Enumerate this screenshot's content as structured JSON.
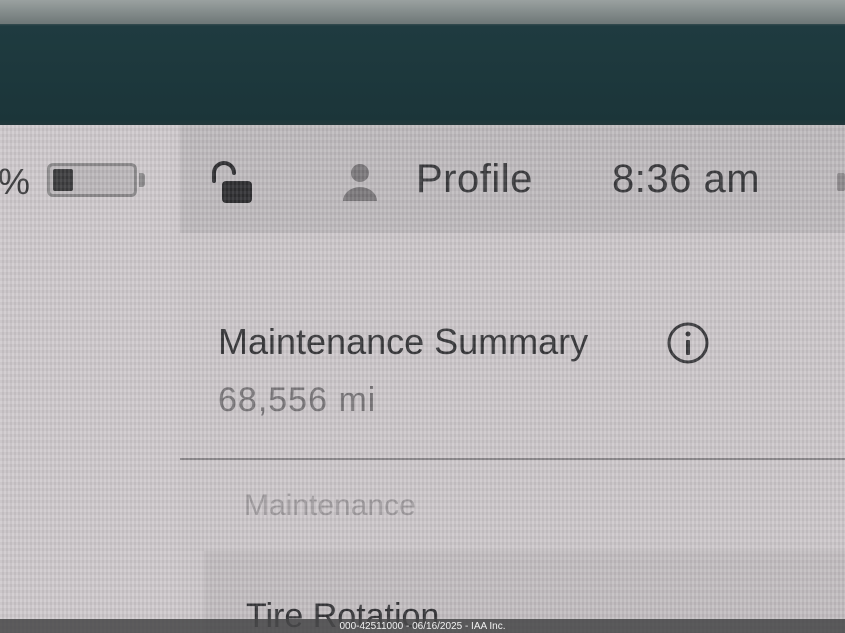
{
  "battery": {
    "percent_suffix": "%",
    "level": 0.25
  },
  "status_bar": {
    "lock_icon": "lock-open-icon",
    "profile_icon": "person-icon",
    "profile_label": "Profile",
    "time": "8:36 am"
  },
  "summary": {
    "title": "Maintenance Summary",
    "info_icon": "info-icon",
    "mileage": "68,556  mi"
  },
  "tabs": {
    "maintenance_label": "Maintenance"
  },
  "list": {
    "items": [
      {
        "label": "Tire Rotation"
      }
    ]
  },
  "watermark": "000-42511000 - 06/16/2025 - IAA Inc.",
  "colors": {
    "screen_bg": "#cdc8cb",
    "status_bg": "#bfbbbe",
    "text": "#37373a",
    "muted_text": "#7a777a",
    "bezel": "#1b3539"
  }
}
